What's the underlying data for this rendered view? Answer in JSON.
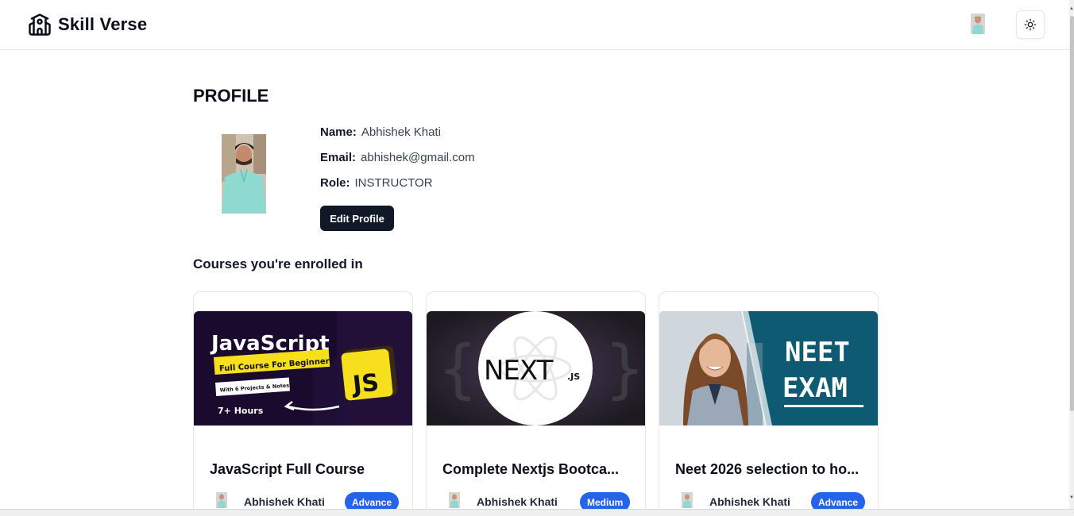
{
  "header": {
    "brand": "Skill Verse"
  },
  "profile": {
    "title": "PROFILE",
    "name_label": "Name:",
    "name": "Abhishek Khati",
    "email_label": "Email:",
    "email": "abhishek@gmail.com",
    "role_label": "Role:",
    "role": "INSTRUCTOR",
    "edit_label": "Edit Profile"
  },
  "enrolled_title": "Courses you're enrolled in",
  "courses": [
    {
      "title": "JavaScript Full Course",
      "author": "Abhishek Khati",
      "level": "Advance",
      "thumb": {
        "heading": "JavaScript",
        "tag": "Full Course For Beginners",
        "sub": "With 6 Projects & Notes",
        "hours": "7+ Hours",
        "logo": "JS"
      }
    },
    {
      "title": "Complete Nextjs Bootca...",
      "author": "Abhishek Khati",
      "level": "Medium",
      "thumb": {
        "logo": "NEXT",
        "logo_suffix": ".JS"
      }
    },
    {
      "title": "Neet 2026 selection to ho...",
      "author": "Abhishek Khati",
      "level": "Advance",
      "thumb": {
        "line1": "NEET",
        "line2": "EXAM"
      }
    }
  ],
  "colors": {
    "primary_dark": "#111827",
    "badge_blue": "#2563eb",
    "js_yellow": "#f7df1e"
  }
}
